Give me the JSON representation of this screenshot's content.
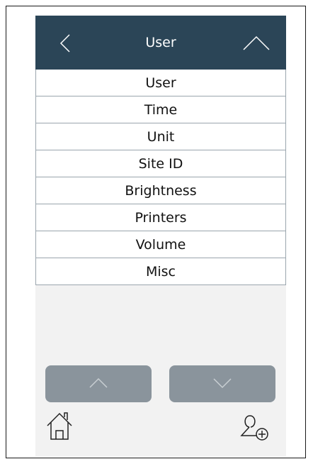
{
  "header": {
    "title": "User",
    "back_icon": "chevron-left-icon",
    "collapse_icon": "chevron-up-icon"
  },
  "menu": {
    "items": [
      {
        "label": "User"
      },
      {
        "label": "Time"
      },
      {
        "label": "Unit"
      },
      {
        "label": "Site ID"
      },
      {
        "label": "Brightness"
      },
      {
        "label": "Printers"
      },
      {
        "label": "Volume"
      },
      {
        "label": "Misc"
      }
    ]
  },
  "footer": {
    "scroll_up_icon": "chevron-up-icon",
    "scroll_down_icon": "chevron-down-icon",
    "home_icon": "home-icon",
    "add_user_icon": "add-user-icon"
  },
  "colors": {
    "header_bg": "#2b4557",
    "screen_bg": "#f2f2f2",
    "button_bg": "#8a949c",
    "divider": "#9aa5ad"
  }
}
